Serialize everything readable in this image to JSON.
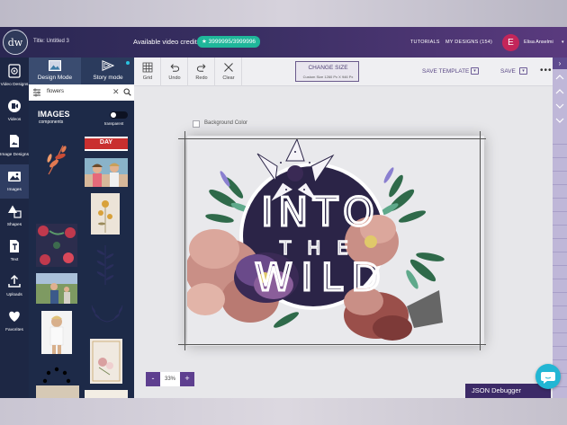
{
  "app": {
    "logo_text": "dw",
    "title": "Title: Untitled 3",
    "credits_label": "Available video credits",
    "credits_value": "★ 3999995/3999996",
    "links": {
      "tutorials": "TUTORIALS",
      "my_designs": "MY DESIGNS (154)"
    },
    "user": {
      "initial": "E",
      "name": "Elisa Anselmi",
      "caret": "▾"
    },
    "colors": {
      "topbar": "#2a2752",
      "accent": "#5e3f8f",
      "credits": "#1fb79a",
      "rail": "#1d2744"
    }
  },
  "rail": [
    {
      "label": "Video Designs",
      "icon": "video-designs-icon"
    },
    {
      "label": "Videos",
      "icon": "videos-icon"
    },
    {
      "label": "Image Designs",
      "icon": "image-designs-icon"
    },
    {
      "label": "Images",
      "icon": "images-icon"
    },
    {
      "label": "Shapes",
      "icon": "shapes-icon"
    },
    {
      "label": "Text",
      "icon": "text-icon"
    },
    {
      "label": "Uploads",
      "icon": "uploads-icon"
    },
    {
      "label": "Favorites",
      "icon": "heart-icon"
    }
  ],
  "panel": {
    "tabs": {
      "design": "Design Mode",
      "story": "Story mode"
    },
    "search": {
      "value": "flowers",
      "clear": "✕"
    },
    "heading": "IMAGES",
    "subheading": "components",
    "toggle_label": "transparent",
    "thumb_day_text": "DAY"
  },
  "toolbar": {
    "grid": "Grid",
    "undo": "Undo",
    "redo": "Redo",
    "clear": "Clear",
    "change_size": "CHANGE SIZE",
    "custom_size": "Custom Size 1260 Px X 946 Px",
    "save_template": "SAVE TEMPLATE",
    "save": "SAVE",
    "caret": "▾",
    "more": "•••"
  },
  "canvas": {
    "bg_label": "Background Color",
    "art_line1": "INTO",
    "art_line2": "THE",
    "art_line3": "WILD"
  },
  "zoom": {
    "minus": "-",
    "value": "33%",
    "plus": "+"
  },
  "json_debugger": "JSON Debugger",
  "rightbar": {
    "toggle": "›"
  }
}
